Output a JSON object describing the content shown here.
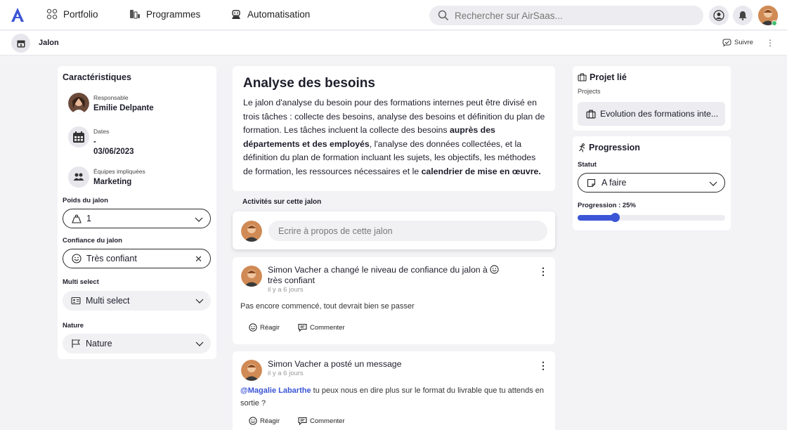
{
  "colors": {
    "accent": "#3b55d6",
    "background": "#f3f3f6",
    "online": "#3fbf6a"
  },
  "nav": {
    "logo_icon": "airsaas-logo-icon",
    "items": [
      {
        "label": "Portfolio",
        "icon": "portfolio-icon"
      },
      {
        "label": "Programmes",
        "icon": "programmes-icon"
      },
      {
        "label": "Automatisation",
        "icon": "robot-icon"
      }
    ],
    "search_placeholder": "Rechercher sur AirSaas..."
  },
  "subheader": {
    "title": "Jalon",
    "follow_label": "Suivre",
    "more": "⋮"
  },
  "characteristics": {
    "title": "Caractéristiques",
    "responsable": {
      "label": "Responsable",
      "value": "Emilie Delpante"
    },
    "dates": {
      "label": "Dates",
      "start": "-",
      "end": "03/06/2023"
    },
    "teams": {
      "label": "Équipes impliquées",
      "value": "Marketing"
    },
    "weight": {
      "label": "Poids du jalon",
      "value": "1"
    },
    "confidence": {
      "label": "Confiance du jalon",
      "value": "Très confiant",
      "clear": "✕"
    },
    "multi": {
      "label": "Multi select",
      "value": "Multi select"
    },
    "nature": {
      "label": "Nature",
      "value": "Nature"
    }
  },
  "description": {
    "title": "Analyse des besoins",
    "p1": "Le jalon d'analyse du besoin pour des formations internes peut être divisé en trois tâches : collecte des besoins, analyse des besoins et définition du plan de formation. Les tâches incluent la collecte des besoins ",
    "b1": "auprès des départements et des employés",
    "p2": ", l'analyse des données collectées, et la définition du plan de formation incluant les sujets, les objectifs, les méthodes de formation, les ressources nécessaires et le ",
    "b2": "calendrier de mise en œuvre."
  },
  "activities": {
    "label": "Activités sur cette jalon",
    "composer_placeholder": "Ecrire à propos de cette jalon",
    "posts": [
      {
        "headline_a": "Simon Vacher a changé le niveau de confiance du jalon à ",
        "headline_b": " très confiant",
        "when": "il y a 6 jours",
        "body": "Pas encore commencé, tout devrait bien se passer",
        "react": "Réagir",
        "comment": "Commenter"
      },
      {
        "headline": "Simon Vacher a posté un message",
        "when": "il y a 6 jours",
        "mention": "@Magalie Labarthe",
        "body": " tu peux nous en dire plus sur le format du livrable que tu attends en sortie ?",
        "react": "Réagir",
        "comment": "Commenter"
      }
    ]
  },
  "linked_project": {
    "title": "Projet lié",
    "subtitle": "Projects",
    "project": "Evolution des formations inte..."
  },
  "progress": {
    "title": "Progression",
    "status_label": "Statut",
    "status_value": "A faire",
    "progress_label": "Progression : 25%",
    "progress_fraction": 0.25
  }
}
